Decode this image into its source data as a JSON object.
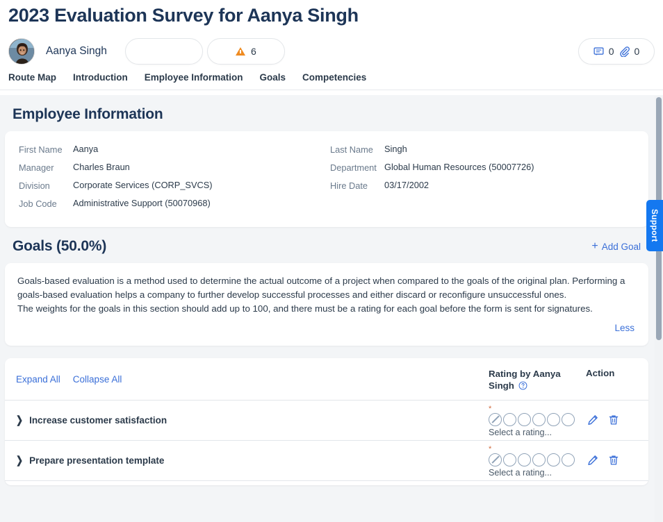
{
  "header": {
    "page_title": "2023 Evaluation Survey for Aanya Singh",
    "employee_name": "Aanya Singh",
    "empty_pill_label": "",
    "alert_count": "6",
    "comment_count": "0",
    "attachment_count": "0",
    "comment_icon": "comment-icon",
    "attachment_icon": "paperclip-icon",
    "alert_icon": "warning-triangle-icon",
    "avatar_icon": "user-avatar-photo"
  },
  "nav": {
    "tabs": [
      {
        "label": "Route Map"
      },
      {
        "label": "Introduction"
      },
      {
        "label": "Employee Information"
      },
      {
        "label": "Goals"
      },
      {
        "label": "Competencies"
      }
    ]
  },
  "employee_information": {
    "section_title": "Employee Information",
    "fields_left": [
      {
        "label": "First Name",
        "value": "Aanya"
      },
      {
        "label": "Manager",
        "value": "Charles Braun"
      },
      {
        "label": "Division",
        "value": "Corporate Services (CORP_SVCS)"
      },
      {
        "label": "Job Code",
        "value": "Administrative Support (50070968)"
      }
    ],
    "fields_right": [
      {
        "label": "Last Name",
        "value": "Singh"
      },
      {
        "label": "Department",
        "value": "Global Human Resources (50007726)"
      },
      {
        "label": "Hire Date",
        "value": "03/17/2002"
      }
    ]
  },
  "goals": {
    "section_title": "Goals (50.0%)",
    "add_goal_label": "Add Goal",
    "description_p1": "Goals-based evaluation is a method used to determine the actual outcome of a project when compared to the goals of the original plan. Performing a goals-based evaluation helps a company to further develop successful processes and either discard or reconfigure unsuccessful ones.",
    "description_p2": "The weights for the goals in this section should add up to 100, and there must be a rating for each goal before the form is sent for signatures.",
    "less_label": "Less",
    "expand_all_label": "Expand All",
    "collapse_all_label": "Collapse All",
    "col_rating_label": "Rating by Aanya Singh",
    "col_action_label": "Action",
    "help_icon": "question-circle-icon",
    "rating_placeholder": "Select a rating...",
    "required_mark": "*",
    "edit_icon": "pencil-icon",
    "delete_icon": "trash-icon",
    "expand_chevron_icon": "chevron-right-icon",
    "rating_scale_count": 6,
    "rows": [
      {
        "name": "Increase customer satisfaction",
        "rating": "Select a rating..."
      },
      {
        "name": "Prepare presentation template",
        "rating": "Select a rating..."
      }
    ]
  },
  "support": {
    "label": "Support"
  },
  "colors": {
    "accent_blue": "#3a6fd8",
    "title_navy": "#1d3557",
    "warn_orange": "#ef8b21",
    "support_blue": "#1478f0",
    "required_red": "#d06a3c"
  }
}
